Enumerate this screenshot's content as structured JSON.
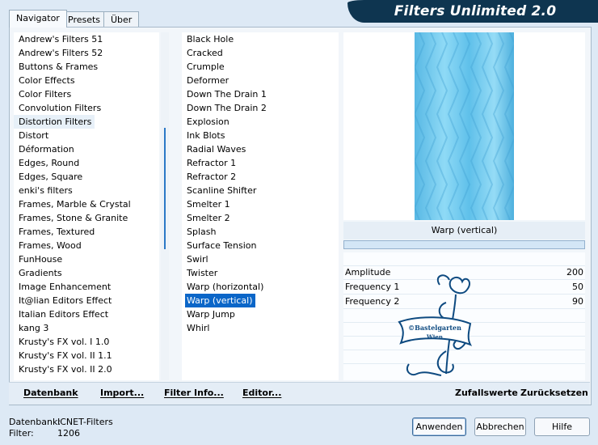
{
  "app": {
    "title": "Filters Unlimited 2.0"
  },
  "tabs": [
    {
      "label": "Navigator",
      "active": true
    },
    {
      "label": "Presets",
      "active": false
    },
    {
      "label": "Über",
      "active": false
    }
  ],
  "categories": {
    "selected_index": 6,
    "items": [
      "Andrew's Filters 51",
      "Andrew's Filters 52",
      "Buttons & Frames",
      "Color Effects",
      "Color Filters",
      "Convolution Filters",
      "Distortion Filters",
      "Distort",
      "Déformation",
      "Edges, Round",
      "Edges, Square",
      "enki's filters",
      "Frames, Marble & Crystal",
      "Frames, Stone & Granite",
      "Frames, Textured",
      "Frames, Wood",
      "FunHouse",
      "Gradients",
      "Image Enhancement",
      "It@lian Editors Effect",
      "Italian Editors Effect",
      "kang 3",
      "Krusty's FX vol. I 1.0",
      "Krusty's FX vol. II 1.1",
      "Krusty's FX vol. II 2.0"
    ]
  },
  "filters": {
    "selected_index": 19,
    "items": [
      "Black Hole",
      "Cracked",
      "Crumple",
      "Deformer",
      "Down The Drain 1",
      "Down The Drain 2",
      "Explosion",
      "Ink Blots",
      "Radial Waves",
      "Refractor 1",
      "Refractor 2",
      "Scanline Shifter",
      "Smelter 1",
      "Smelter 2",
      "Splash",
      "Surface Tension",
      "Swirl",
      "Twister",
      "Warp (horizontal)",
      "Warp (vertical)",
      "Warp Jump",
      "Whirl"
    ]
  },
  "preview": {
    "filter_name": "Warp (vertical)"
  },
  "parameters": [
    {
      "label": "Amplitude",
      "value": "200"
    },
    {
      "label": "Frequency 1",
      "value": "50"
    },
    {
      "label": "Frequency 2",
      "value": "90"
    }
  ],
  "watermark": {
    "line1": "©Bastelgarten",
    "line2": "Wien"
  },
  "toolbar": {
    "database": "Datenbank",
    "import": "Import...",
    "filter_info": "Filter Info...",
    "editor": "Editor...",
    "random": "Zufallswerte",
    "reset": "Zurücksetzen"
  },
  "status": {
    "database_label": "Datenbank:",
    "database_value": "ICNET-Filters",
    "filter_label": "Filter:",
    "filter_value": "1206"
  },
  "buttons": {
    "apply": "Anwenden",
    "cancel": "Abbrechen",
    "help": "Hilfe"
  },
  "colors": {
    "banner": "#0e3550",
    "selection": "#0b66c8",
    "preview": "#7fd0f2"
  }
}
